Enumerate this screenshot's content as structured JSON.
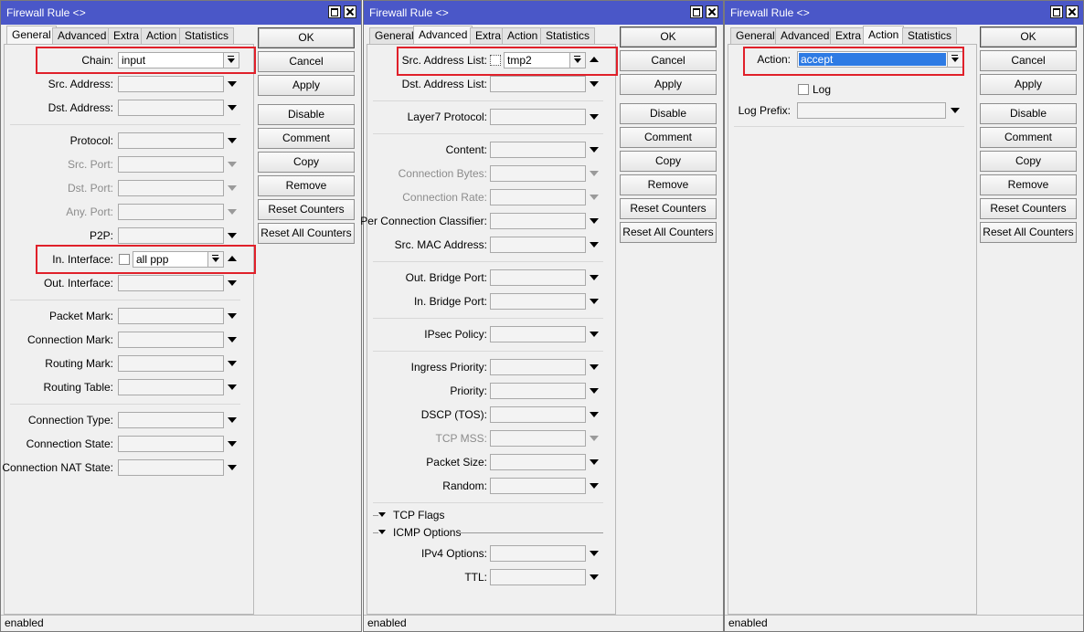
{
  "windows": [
    {
      "title": "Firewall Rule <>",
      "tabs": [
        "General",
        "Advanced",
        "Extra",
        "Action",
        "Statistics"
      ],
      "active_tab": "General",
      "fields": {
        "chain": {
          "label": "Chain:",
          "value": "input"
        },
        "src_address": {
          "label": "Src. Address:"
        },
        "dst_address": {
          "label": "Dst. Address:"
        },
        "protocol": {
          "label": "Protocol:"
        },
        "src_port": {
          "label": "Src. Port:"
        },
        "dst_port": {
          "label": "Dst. Port:"
        },
        "any_port": {
          "label": "Any. Port:"
        },
        "p2p": {
          "label": "P2P:"
        },
        "in_interface": {
          "label": "In. Interface:",
          "value": "all ppp"
        },
        "out_interface": {
          "label": "Out. Interface:"
        },
        "packet_mark": {
          "label": "Packet Mark:"
        },
        "connection_mark": {
          "label": "Connection Mark:"
        },
        "routing_mark": {
          "label": "Routing Mark:"
        },
        "routing_table": {
          "label": "Routing Table:"
        },
        "connection_type": {
          "label": "Connection Type:"
        },
        "connection_state": {
          "label": "Connection State:"
        },
        "connection_nat_state": {
          "label": "Connection NAT State:"
        }
      },
      "status": "enabled"
    },
    {
      "title": "Firewall Rule <>",
      "tabs": [
        "General",
        "Advanced",
        "Extra",
        "Action",
        "Statistics"
      ],
      "active_tab": "Advanced",
      "fields": {
        "src_address_list": {
          "label": "Src. Address List:",
          "value": "tmp2"
        },
        "dst_address_list": {
          "label": "Dst. Address List:"
        },
        "layer7_protocol": {
          "label": "Layer7 Protocol:"
        },
        "content": {
          "label": "Content:"
        },
        "connection_bytes": {
          "label": "Connection Bytes:"
        },
        "connection_rate": {
          "label": "Connection Rate:"
        },
        "per_connection_classifier": {
          "label": "Per Connection Classifier:"
        },
        "src_mac_address": {
          "label": "Src. MAC Address:"
        },
        "out_bridge_port": {
          "label": "Out. Bridge Port:"
        },
        "in_bridge_port": {
          "label": "In. Bridge Port:"
        },
        "ipsec_policy": {
          "label": "IPsec Policy:"
        },
        "ingress_priority": {
          "label": "Ingress Priority:"
        },
        "priority": {
          "label": "Priority:"
        },
        "dscp": {
          "label": "DSCP (TOS):"
        },
        "tcp_mss": {
          "label": "TCP MSS:"
        },
        "packet_size": {
          "label": "Packet Size:"
        },
        "random": {
          "label": "Random:"
        },
        "ipv4_options": {
          "label": "IPv4 Options:"
        },
        "ttl": {
          "label": "TTL:"
        }
      },
      "sections": {
        "tcp_flags": "TCP Flags",
        "icmp_options": "ICMP Options"
      },
      "status": "enabled"
    },
    {
      "title": "Firewall Rule <>",
      "tabs": [
        "General",
        "Advanced",
        "Extra",
        "Action",
        "Statistics"
      ],
      "active_tab": "Action",
      "fields": {
        "action": {
          "label": "Action:",
          "value": "accept"
        },
        "log": {
          "label": "Log"
        },
        "log_prefix": {
          "label": "Log Prefix:"
        }
      },
      "status": "enabled"
    }
  ],
  "buttons": [
    "OK",
    "Cancel",
    "Apply",
    "Disable",
    "Comment",
    "Copy",
    "Remove",
    "Reset Counters",
    "Reset All Counters"
  ],
  "colors": {
    "titlebar": "#4a57c8",
    "highlight": "#e0202a",
    "selection": "#2e7be4"
  }
}
